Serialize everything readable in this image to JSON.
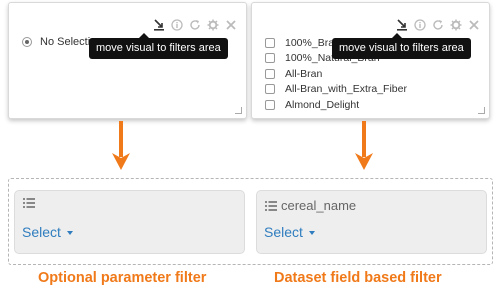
{
  "left_visual": {
    "radio_label": "No Selection",
    "tooltip": "move visual to filters area",
    "toolbar_icons": [
      "move-to-filters-icon",
      "info-icon",
      "refresh-icon",
      "gear-icon",
      "close-icon"
    ]
  },
  "right_visual": {
    "options": [
      "100%_Bran",
      "100%_Natural_Bran",
      "All-Bran",
      "All-Bran_with_Extra_Fiber",
      "Almond_Delight"
    ],
    "tooltip": "move visual to filters area",
    "toolbar_icons": [
      "move-to-filters-icon",
      "info-icon",
      "refresh-icon",
      "gear-icon",
      "close-icon"
    ]
  },
  "filters": [
    {
      "name": "",
      "select_label": "Select"
    },
    {
      "name": "cereal_name",
      "select_label": "Select"
    }
  ],
  "captions": {
    "left": "Optional parameter filter",
    "right": "Dataset field based filter"
  },
  "colors": {
    "accent": "#f07a1a",
    "link": "#2f7dbf",
    "tooltip_bg": "#111111"
  }
}
